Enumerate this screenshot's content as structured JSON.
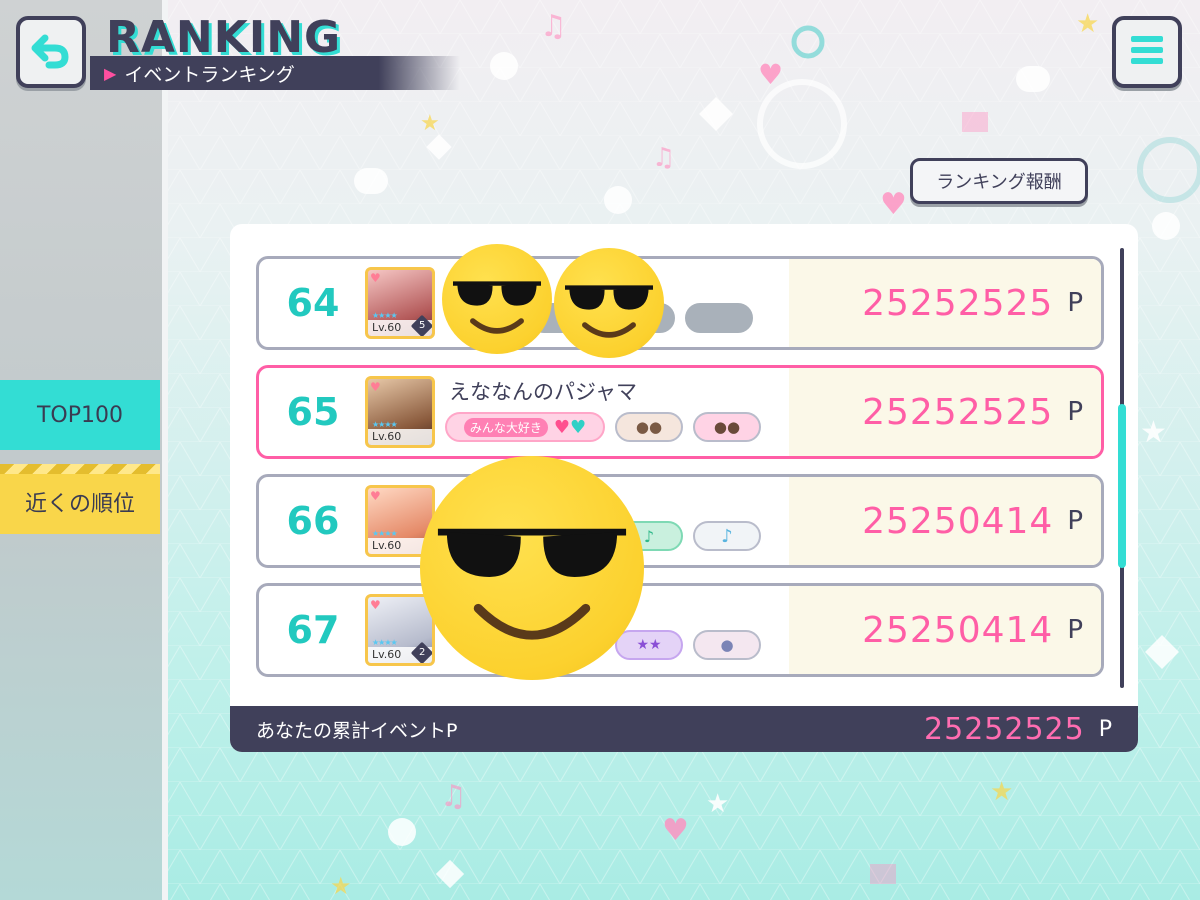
{
  "header": {
    "title": "RANKING",
    "subtitle": "イベントランキング",
    "reward_button": "ランキング報酬"
  },
  "sidebar": {
    "tabs": [
      {
        "label": "TOP100",
        "active": true
      },
      {
        "label": "近くの順位",
        "active": false
      }
    ]
  },
  "ranking": {
    "rows": [
      {
        "rank": "64",
        "name": "",
        "level": "Lv.60",
        "master_rank": "5",
        "score": "25252525",
        "unit": "P",
        "highlight": false
      },
      {
        "rank": "65",
        "name": "えななんのパジャマ",
        "level": "Lv.60",
        "master_rank": "",
        "title_badge": "みんな大好き",
        "score": "25252525",
        "unit": "P",
        "highlight": true
      },
      {
        "rank": "66",
        "name": "",
        "level": "Lv.60",
        "master_rank": "",
        "score": "25250414",
        "unit": "P",
        "highlight": false
      },
      {
        "rank": "67",
        "name": "",
        "level": "Lv.60",
        "master_rank": "2",
        "score": "25250414",
        "unit": "P",
        "highlight": false
      }
    ]
  },
  "footer": {
    "label": "あなたの累計イベントP",
    "total": "25252525",
    "unit": "P"
  },
  "colors": {
    "accent": "#33ddd4",
    "dark": "#40405a",
    "score_pink": "#ff5ea6",
    "highlight_border": "#ff5ea6",
    "nearby_tab": "#f9d64a"
  },
  "icons": {
    "back": "back-arrow-icon",
    "menu": "hamburger-menu-icon",
    "overlay": "sunglasses-emoji-icon"
  }
}
